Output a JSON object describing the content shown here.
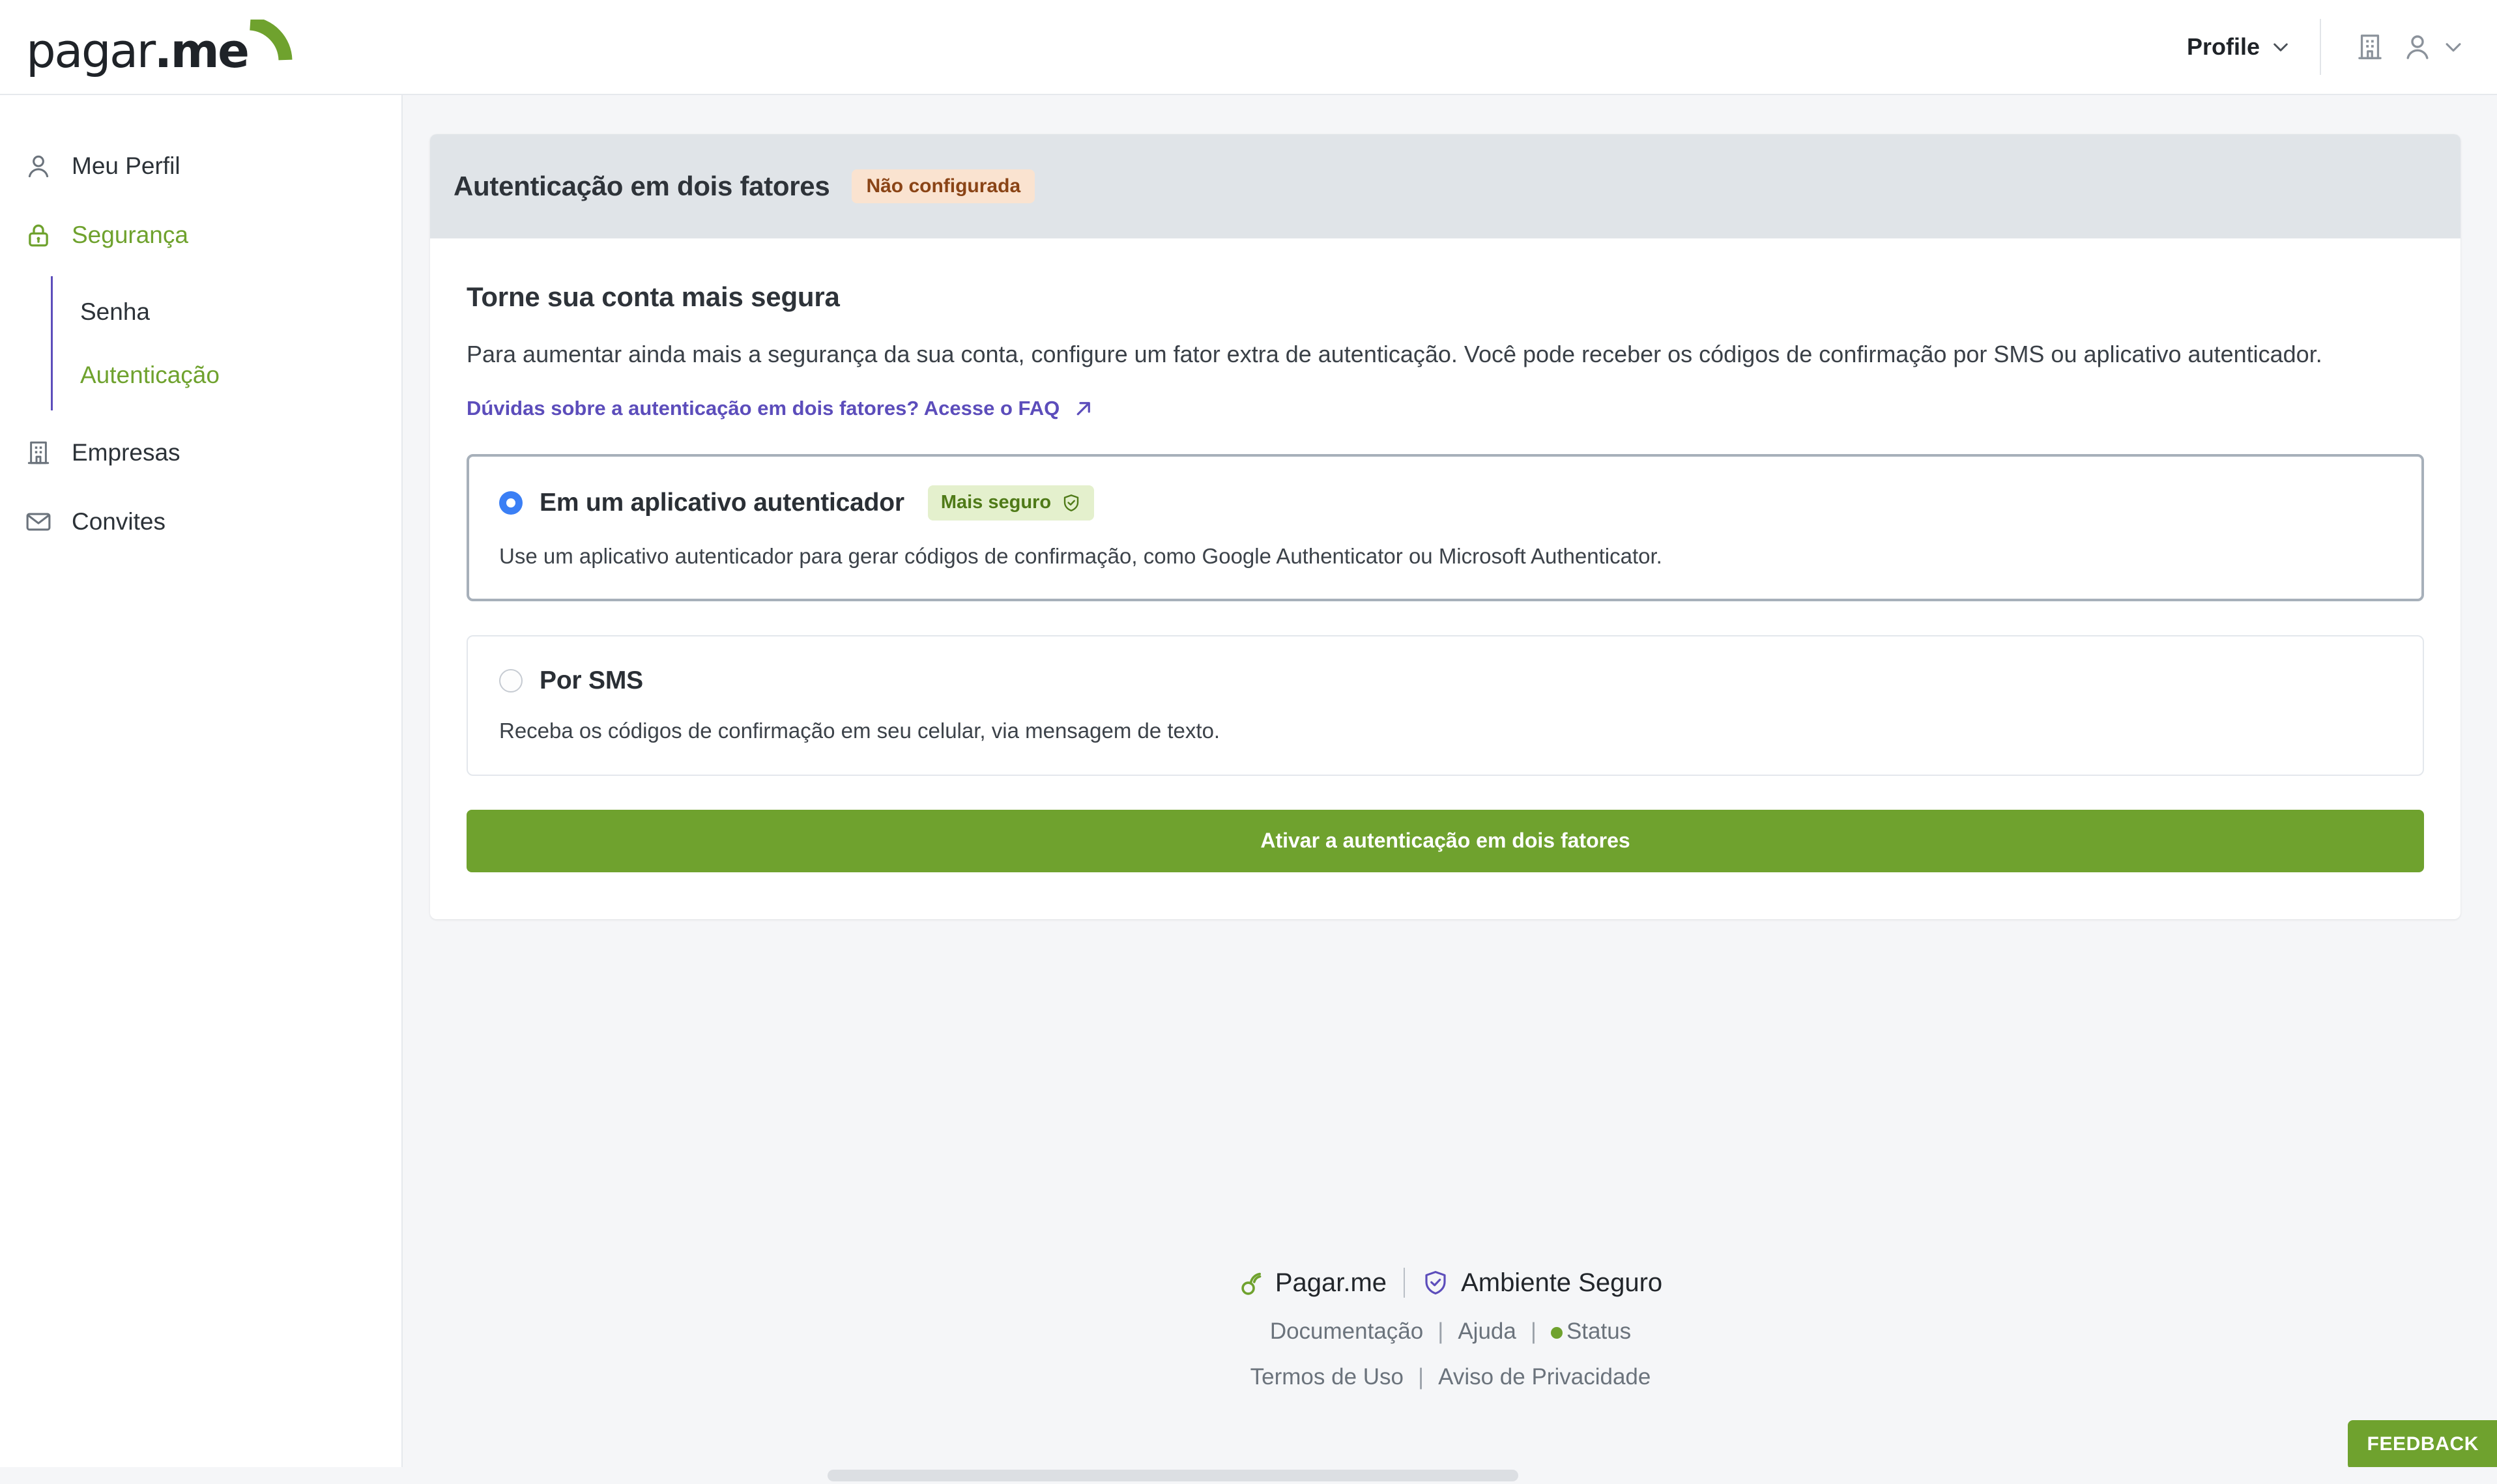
{
  "brand": {
    "name_bold": "pagar",
    "name_dot": ".",
    "name_light": "me",
    "arc_color": "#6fa22e"
  },
  "topbar": {
    "profile_label": "Profile",
    "profile_chevron": "chevron-down-icon",
    "company_icon": "building-icon",
    "user_icon": "user-icon",
    "user_chevron": "chevron-down-icon"
  },
  "sidebar": {
    "items": [
      {
        "label": "Meu Perfil",
        "icon": "user-icon",
        "active": false
      },
      {
        "label": "Segurança",
        "icon": "lock-icon",
        "active": true
      },
      {
        "label": "Empresas",
        "icon": "building-icon",
        "active": false
      },
      {
        "label": "Convites",
        "icon": "envelope-icon",
        "active": false
      }
    ],
    "subitems": [
      {
        "label": "Senha",
        "active": false
      },
      {
        "label": "Autenticação",
        "active": true
      }
    ]
  },
  "card": {
    "title": "Autenticação em dois fatores",
    "status_badge": "Não configurada",
    "heading": "Torne sua conta mais segura",
    "lead": "Para aumentar ainda mais a segurança da sua conta, configure um fator extra de autenticação. Você pode receber os códigos de confirmação por SMS ou aplicativo autenticador.",
    "faq_link": "Dúvidas sobre a autenticação em dois fatores? Acesse o FAQ",
    "faq_icon": "external-link-arrow-icon",
    "options": [
      {
        "label": "Em um aplicativo autenticador",
        "badge": "Mais seguro",
        "badge_icon": "shield-check-icon",
        "description": "Use um aplicativo autenticador para gerar códigos de confirmação, como Google Authenticator ou Microsoft Authenticator.",
        "selected": true
      },
      {
        "label": "Por SMS",
        "badge": null,
        "description": "Receba os códigos de confirmação em seu celular, via mensagem de texto.",
        "selected": false
      }
    ],
    "cta_label": "Ativar a autenticação em dois fatores"
  },
  "footer": {
    "brand_text": "Pagar.me",
    "secure_icon": "shield-check-icon",
    "secure_text": "Ambiente Seguro",
    "links_row1": [
      "Documentação",
      "Ajuda",
      "Status"
    ],
    "links_row2": [
      "Termos de Uso",
      "Aviso de Privacidade"
    ],
    "separator": "|",
    "status_dot_color": "#6fa22e"
  },
  "feedback": {
    "label": "FEEDBACK"
  },
  "colors": {
    "brand_green": "#6fa22e",
    "accent_purple": "#5c4dbb",
    "warn_badge_bg": "#fae3d0",
    "warn_badge_fg": "#8a4416",
    "safe_badge_bg": "#e4f0cd",
    "safe_badge_fg": "#4f7a18",
    "radio_blue": "#3b7ff5",
    "card_head_bg": "#e0e4e8",
    "page_bg": "#f5f6f8"
  }
}
